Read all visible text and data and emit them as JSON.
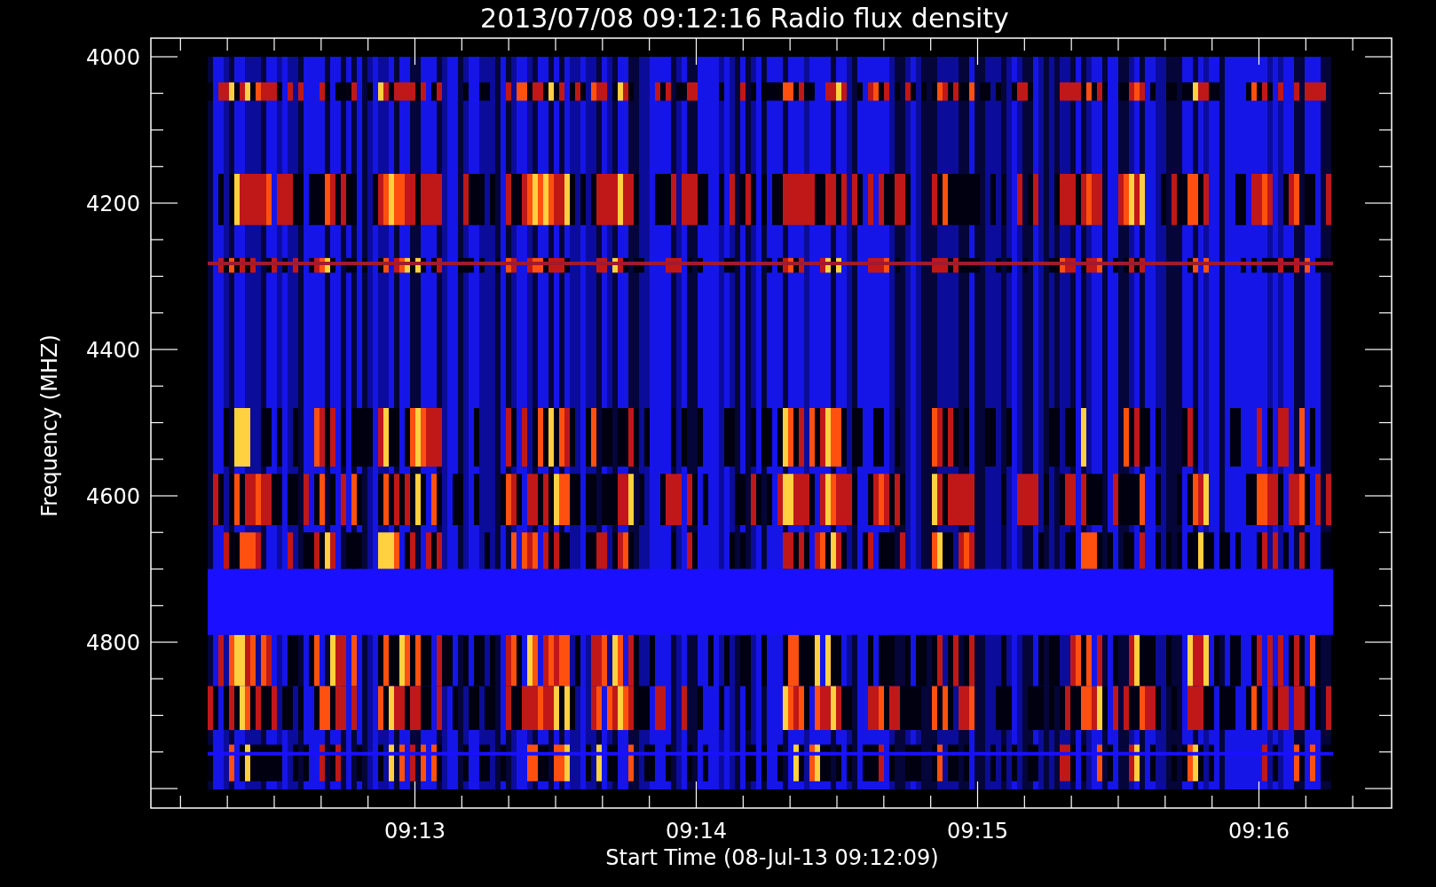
{
  "title": "2013/07/08 09:12:16 Radio flux density",
  "y_axis": {
    "label": "Frequency (MHZ)",
    "ticks": [
      "4000",
      "4200",
      "4400",
      "4600",
      "4800"
    ]
  },
  "x_axis": {
    "label": "Start Time (08-Jul-13 09:12:09)",
    "ticks": [
      "09:13",
      "09:14",
      "09:15",
      "09:16"
    ]
  }
}
